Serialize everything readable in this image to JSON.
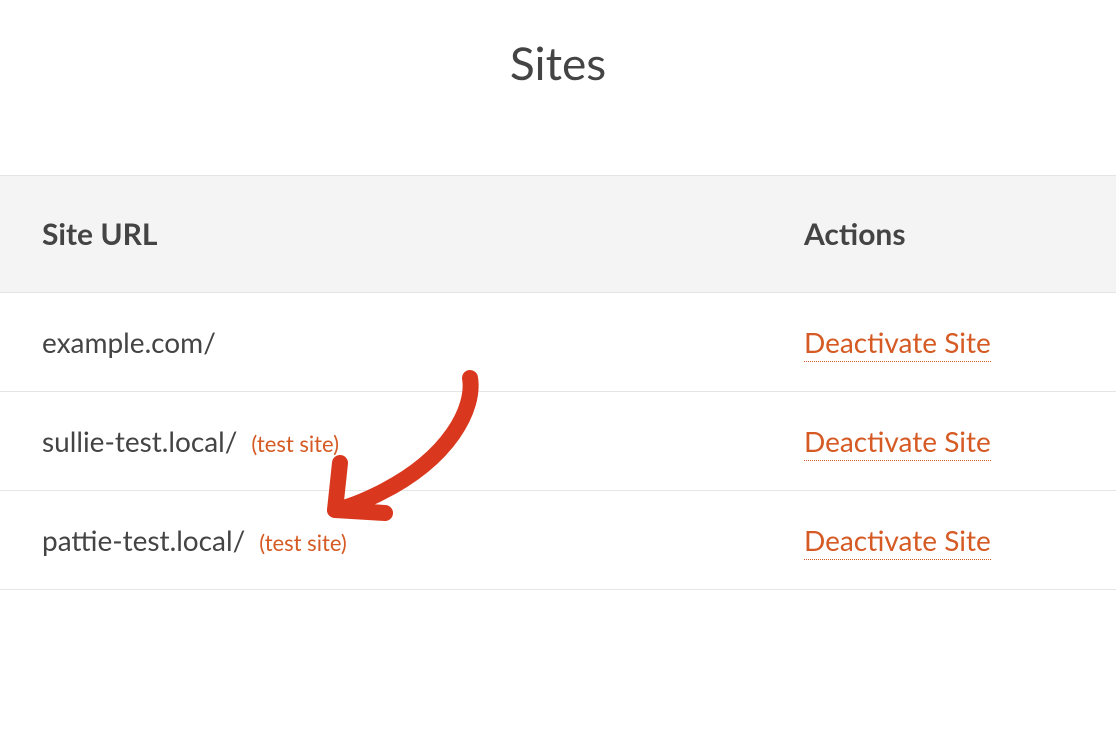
{
  "page": {
    "title": "Sites"
  },
  "table": {
    "headers": {
      "url": "Site URL",
      "actions": "Actions"
    },
    "rows": [
      {
        "url": "example.com/",
        "badge": "",
        "action": "Deactivate Site"
      },
      {
        "url": "sullie-test.local/",
        "badge": "(test site)",
        "action": "Deactivate Site"
      },
      {
        "url": "pattie-test.local/",
        "badge": "(test site)",
        "action": "Deactivate Site"
      }
    ]
  },
  "colors": {
    "accent": "#d55a24",
    "arrow": "#d9381e"
  }
}
